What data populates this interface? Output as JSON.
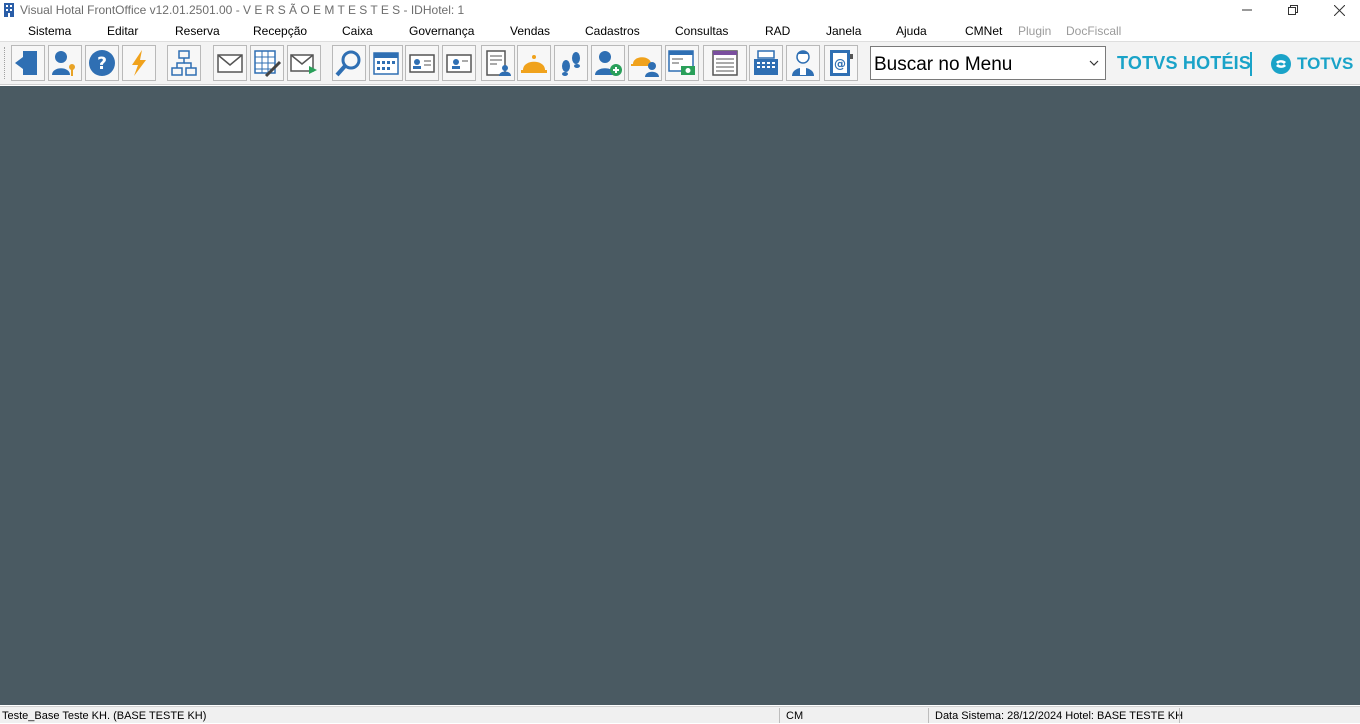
{
  "window": {
    "title": "Visual Hotal FrontOffice v12.01.2501.00 - V E R S Ã O  E M  T E S T E S - IDHotel: 1"
  },
  "menu": [
    {
      "label": "Sistema"
    },
    {
      "label": "Editar"
    },
    {
      "label": "Reserva"
    },
    {
      "label": "Recepção"
    },
    {
      "label": "Caixa"
    },
    {
      "label": "Governança"
    },
    {
      "label": "Vendas"
    },
    {
      "label": "Cadastros"
    },
    {
      "label": "Consultas"
    },
    {
      "label": "RAD"
    },
    {
      "label": "Janela"
    },
    {
      "label": "Ajuda"
    },
    {
      "label": "CMNet"
    },
    {
      "label": "Plugin"
    },
    {
      "label": "DocFiscall"
    }
  ],
  "toolbar": {
    "icons": [
      "exit-icon",
      "user-key-icon",
      "help-icon",
      "lightning-icon",
      "network-icon",
      "mail-icon",
      "spreadsheet-edit-icon",
      "mail-send-icon",
      "search-icon",
      "calendar-icon",
      "guest-card-icon",
      "guest-card-alt-icon",
      "document-person-icon",
      "bell-icon",
      "footsteps-icon",
      "add-guest-icon",
      "group-bell-icon",
      "cash-window-icon",
      "list-icon",
      "cash-register-icon",
      "housekeeper-icon",
      "email-book-icon"
    ],
    "search": {
      "value": "Buscar no Menu"
    }
  },
  "brand": {
    "product": "TOTVS HOTÉIS",
    "company": "TOTVS",
    "color": "#1aa3c8"
  },
  "status": {
    "database": "Teste_Base Teste KH. (BASE TESTE KH)",
    "module": "CM",
    "system_date": "Data Sistema: 28/12/2024  Hotel: BASE TESTE KH"
  },
  "colors": {
    "workspace": "#4a5a62",
    "accent": "#1aa3c8"
  }
}
